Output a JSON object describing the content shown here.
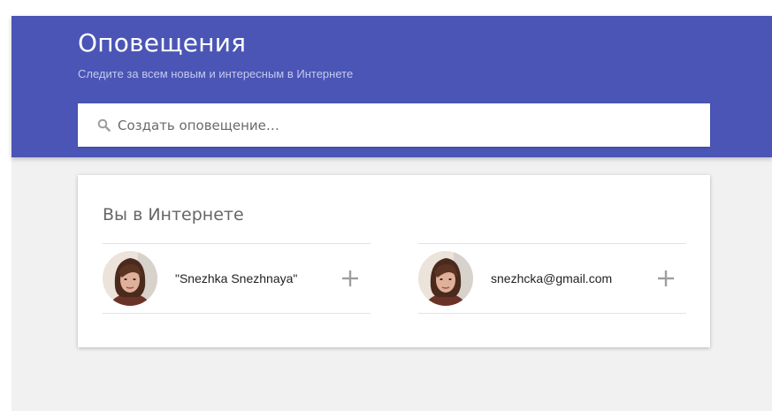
{
  "header": {
    "title": "Оповещения",
    "subtitle": "Следите за всем новым и интересным в Интернете",
    "background_color": "#4a55b5"
  },
  "search": {
    "placeholder": "Создать оповещение…",
    "value": "",
    "icon": "search-icon"
  },
  "you_on_web": {
    "title": "Вы в Интернете",
    "items": [
      {
        "label": "\"Snezhka Snezhnaya\"",
        "avatar": "user-photo",
        "action_icon": "plus-icon"
      },
      {
        "label": "snezhcka@gmail.com",
        "avatar": "user-photo",
        "action_icon": "plus-icon"
      }
    ]
  }
}
